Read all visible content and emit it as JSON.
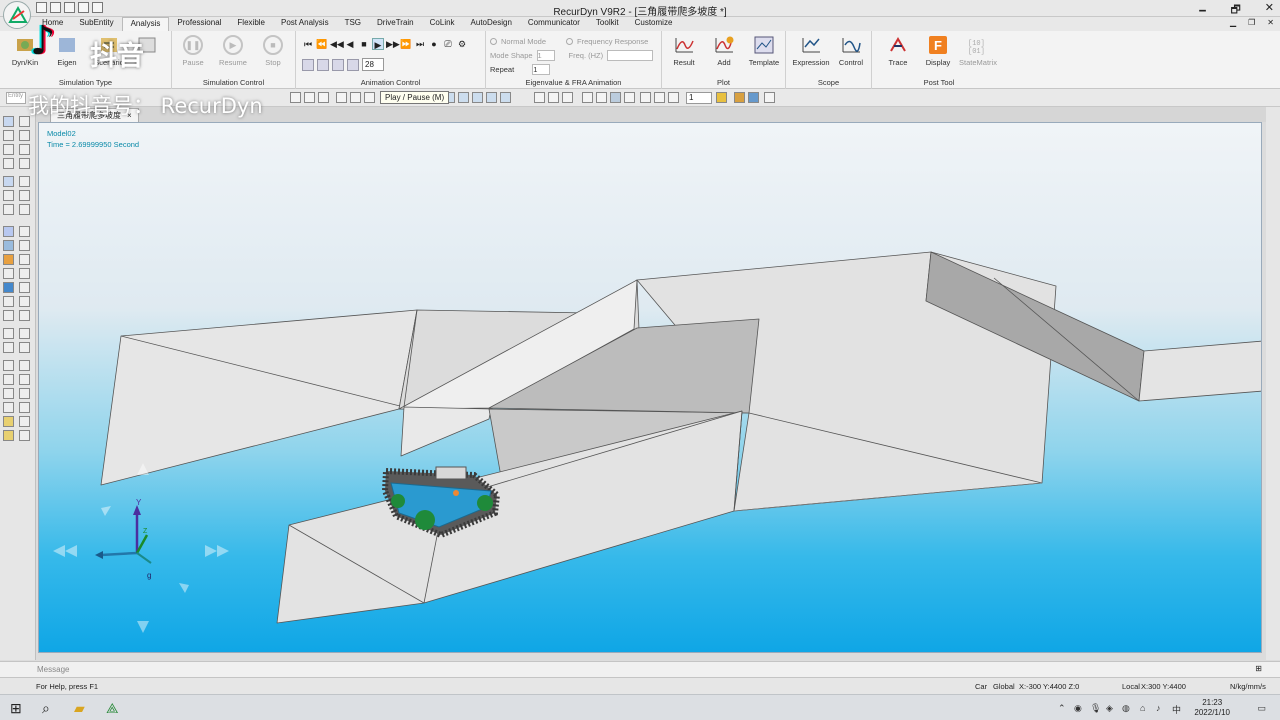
{
  "window": {
    "title": "RecurDyn V9R2  - [三角履带爬多坡度 *]",
    "controls": [
      "🗕",
      "🗗",
      "✕"
    ]
  },
  "ribbon_tabs": [
    "Home",
    "SubEntity",
    "Analysis",
    "Professional",
    "Flexible",
    "Post Analysis",
    "TSG",
    "DriveTrain",
    "CoLink",
    "AutoDesign",
    "Communicator",
    "Toolkit",
    "Customize"
  ],
  "active_tab": "Analysis",
  "ribbon": {
    "simulation_type": {
      "label": "Simulation Type",
      "buttons": [
        "Dyn/Kin",
        "Eigen",
        "Scenario"
      ]
    },
    "simulation_control": {
      "label": "Simulation Control",
      "buttons": [
        "Pause",
        "Resume",
        "Stop"
      ]
    },
    "animation_control": {
      "label": "Animation Control",
      "frame": "28",
      "tooltip": "Play / Pause (M)"
    },
    "eigenvalue": {
      "label": "Eigenvalue & FRA Animation",
      "normal_mode": "Normal Mode",
      "frequency_response": "Frequency Response",
      "mode_shape": "Mode Shape",
      "mode_shape_value": "1",
      "freq": "Freq. (HZ)",
      "repeat": "Repeat",
      "repeat_value": "1"
    },
    "plot": {
      "label": "Plot",
      "buttons": [
        "Result",
        "Add",
        "Template"
      ]
    },
    "scope": {
      "label": "Scope",
      "buttons": [
        "Expression",
        "Control"
      ]
    },
    "post_tool": {
      "label": "Post Tool",
      "buttons": [
        "Trace",
        "Display",
        "StateMatrix"
      ]
    }
  },
  "toolbar": {
    "entity_placeholder": "Entity",
    "zoom_value": "1"
  },
  "document_tab": {
    "label": "三角履带爬多坡度",
    "close": "×"
  },
  "viewport": {
    "model_name": "Model02",
    "time_readout": "Time = 2.69999950 Second",
    "axis_labels": {
      "y": "Y",
      "z": "Z",
      "g": "g"
    }
  },
  "message_bar": {
    "label": "Message"
  },
  "status_bar": {
    "help_text": "For Help, press F1",
    "car": "Car",
    "global": "Global",
    "global_coords": "X:-300 Y:4400 Z:0",
    "local": "Local",
    "local_coords": "X:300 Y:4400",
    "units": "N/kg/mm/s"
  },
  "taskbar": {
    "time": "21:23",
    "date": "2022/1/10",
    "ime": "中"
  },
  "watermark": {
    "brand": "抖音",
    "account": "我的抖音号： RecurDyn"
  },
  "colors": {
    "accent_blue": "#2f7fc4",
    "viewport_top": "#f0f4f7",
    "viewport_bottom": "#0fa6e6",
    "terrain_light": "#e6e6e6",
    "terrain_dark": "#a8a8a8",
    "track_green": "#1f8a3a"
  }
}
